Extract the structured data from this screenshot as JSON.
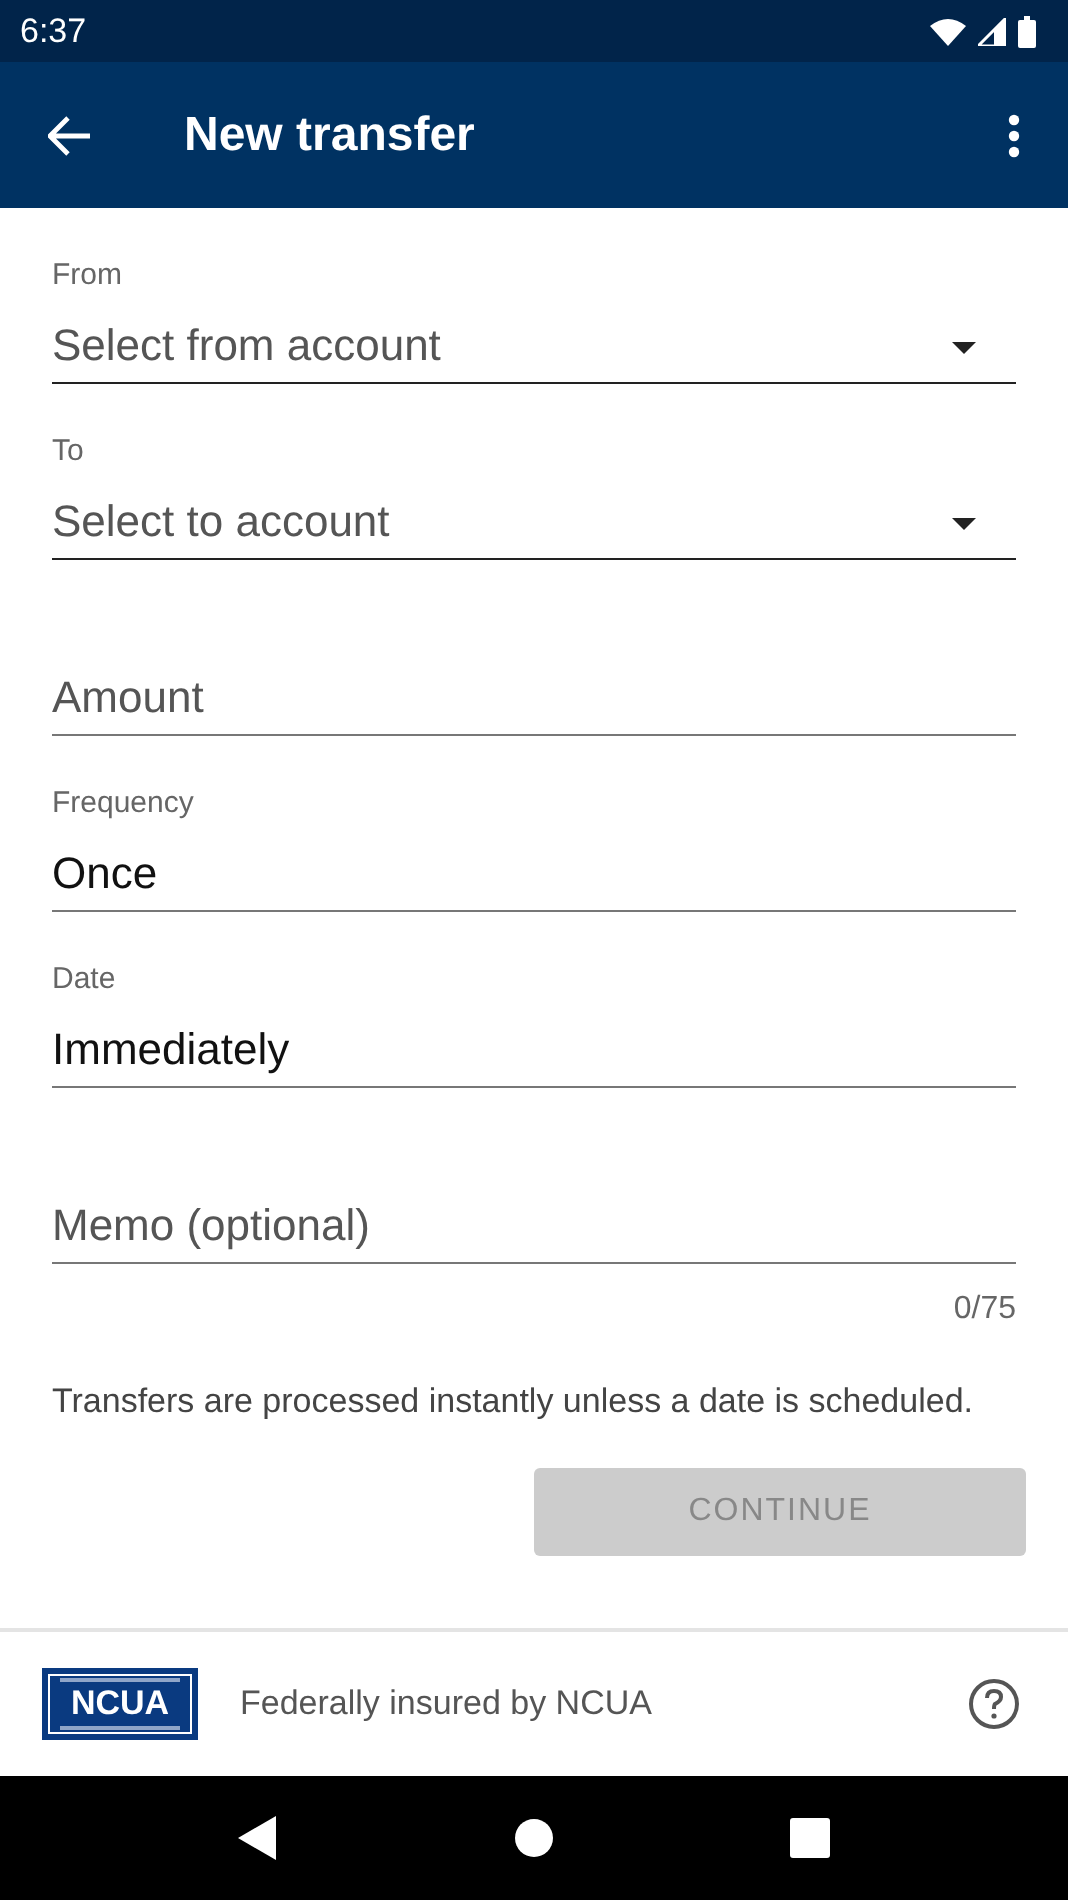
{
  "status_bar": {
    "time": "6:37"
  },
  "app_bar": {
    "title": "New transfer"
  },
  "fields": [
    {
      "kind": "select",
      "label": "From",
      "placeholder": "Select from account"
    },
    {
      "kind": "select",
      "label": "To",
      "placeholder": "Select to account"
    },
    {
      "kind": "text",
      "placeholder": "Amount"
    },
    {
      "kind": "text",
      "label": "Frequency",
      "value": "Once"
    },
    {
      "kind": "text",
      "label": "Date",
      "value": "Immediately"
    },
    {
      "kind": "text",
      "placeholder": "Memo (optional)",
      "counter": "0/75"
    }
  ],
  "note": "Transfers are processed instantly unless a date is scheduled.",
  "button": {
    "label": "CONTINUE",
    "disabled": true
  },
  "footer": {
    "logo": "NCUA",
    "text": "Federally insured by NCUA"
  }
}
